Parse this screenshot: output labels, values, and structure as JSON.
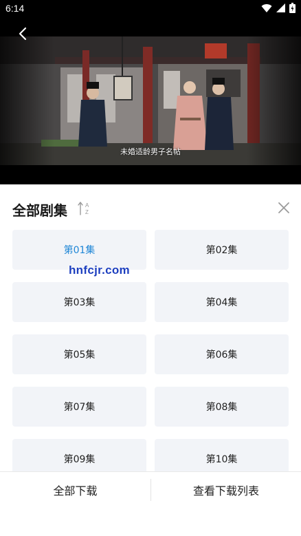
{
  "status": {
    "time": "6:14"
  },
  "player": {
    "subtitle": "未婚适龄男子名帖"
  },
  "sheet": {
    "title": "全部剧集",
    "episodes": [
      {
        "label": "第01集",
        "active": true
      },
      {
        "label": "第02集",
        "active": false
      },
      {
        "label": "第03集",
        "active": false
      },
      {
        "label": "第04集",
        "active": false
      },
      {
        "label": "第05集",
        "active": false
      },
      {
        "label": "第06集",
        "active": false
      },
      {
        "label": "第07集",
        "active": false
      },
      {
        "label": "第08集",
        "active": false
      },
      {
        "label": "第09集",
        "active": false
      },
      {
        "label": "第10集",
        "active": false
      }
    ],
    "watermark": "hnfcjr.com"
  },
  "footer": {
    "download_all": "全部下载",
    "view_downloads": "查看下载列表"
  },
  "icons": {
    "back": "back-arrow-icon",
    "sort": "sort-az-icon",
    "close": "close-icon",
    "wifi": "wifi-icon",
    "signal": "signal-icon",
    "battery": "battery-icon"
  },
  "colors": {
    "accent": "#1f86d6",
    "episode_bg": "#f2f4f8",
    "watermark": "#1d3fbf"
  }
}
